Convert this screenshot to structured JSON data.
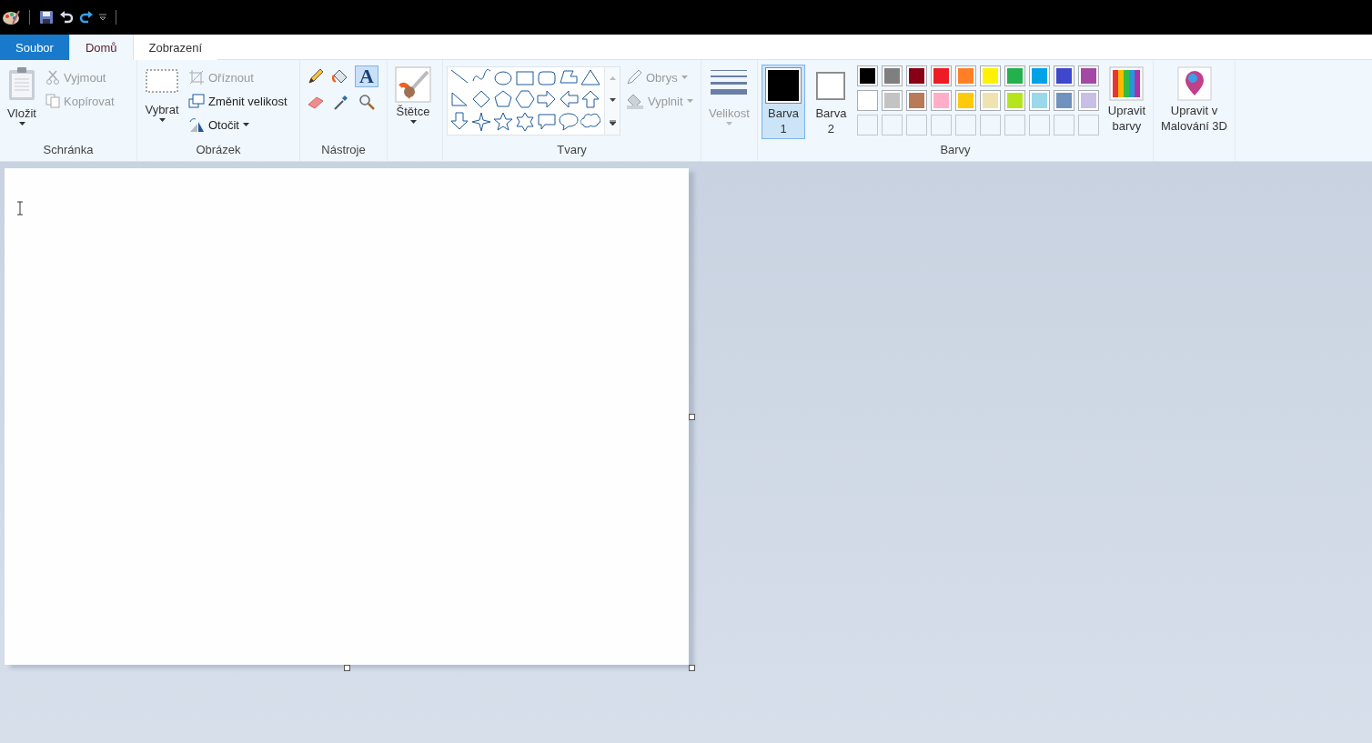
{
  "tabs": [
    {
      "label": "Soubor",
      "kind": "file",
      "selected": false
    },
    {
      "label": "Domů",
      "kind": "tab",
      "selected": true
    },
    {
      "label": "Zobrazení",
      "kind": "tab",
      "selected": false
    }
  ],
  "clipboard": {
    "label": "Schránka",
    "paste": "Vložit",
    "cut": {
      "label": "Vyjmout",
      "disabled": true
    },
    "copy": {
      "label": "Kopírovat",
      "disabled": true
    }
  },
  "image": {
    "label": "Obrázek",
    "select": "Vybrat",
    "crop": {
      "label": "Oříznout",
      "disabled": true
    },
    "resize": {
      "label": "Změnit velikost",
      "disabled": false
    },
    "rotate": {
      "label": "Otočit",
      "disabled": false
    }
  },
  "tools": {
    "label": "Nástroje",
    "items": [
      {
        "kind": "pencil",
        "selected": false
      },
      {
        "kind": "fill",
        "selected": false
      },
      {
        "kind": "text",
        "glyph": "A",
        "selected": true
      },
      {
        "kind": "eraser",
        "selected": false
      },
      {
        "kind": "picker",
        "selected": false
      },
      {
        "kind": "magnifier",
        "selected": false
      }
    ]
  },
  "brushes": {
    "label": "Štětce"
  },
  "shapes": {
    "label": "Tvary",
    "outline": {
      "label": "Obrys",
      "disabled": true
    },
    "fill": {
      "label": "Vyplnit",
      "disabled": true
    }
  },
  "size": {
    "label": "Velikost",
    "disabled": true
  },
  "colors": {
    "label": "Barvy",
    "color1": {
      "label": "Barva 1",
      "color": "#000000",
      "selected": true
    },
    "color2": {
      "label": "Barva 2",
      "color": "#ffffff",
      "selected": false
    },
    "palette": [
      {
        "color": "#000000"
      },
      {
        "color": "#7f7f7f"
      },
      {
        "color": "#880015"
      },
      {
        "color": "#ed1c24"
      },
      {
        "color": "#ff7f27"
      },
      {
        "color": "#fff200"
      },
      {
        "color": "#22b14c"
      },
      {
        "color": "#00a2e8"
      },
      {
        "color": "#3f48cc"
      },
      {
        "color": "#a349a4"
      },
      {
        "color": "#ffffff"
      },
      {
        "color": "#c3c3c3"
      },
      {
        "color": "#b97a57"
      },
      {
        "color": "#ffaec9"
      },
      {
        "color": "#ffc90e"
      },
      {
        "color": "#efe4b0"
      },
      {
        "color": "#b5e61d"
      },
      {
        "color": "#99d9ea"
      },
      {
        "color": "#7092be"
      },
      {
        "color": "#c8bfe7"
      }
    ],
    "edit_colors": "Upravit barvy"
  },
  "paint3d": {
    "label": "Upravit v Malování 3D"
  }
}
